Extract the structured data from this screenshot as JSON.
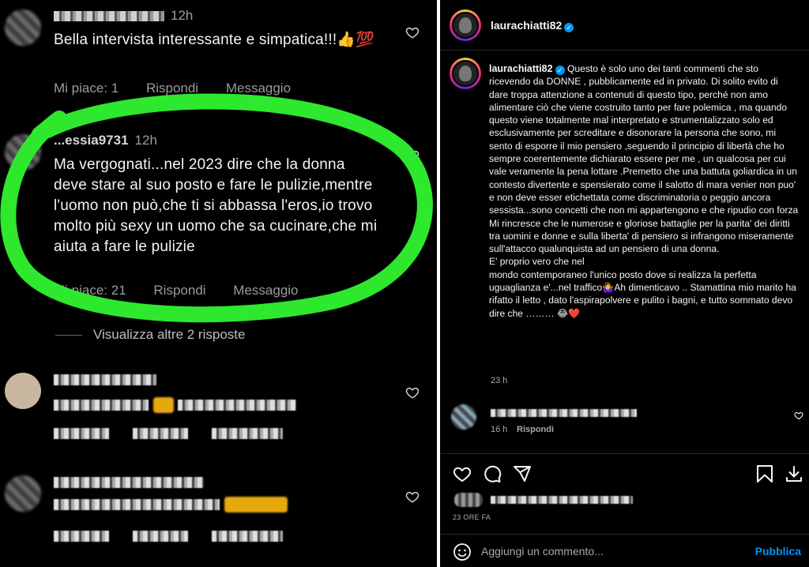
{
  "left_panel": {
    "comments": [
      {
        "time": "12h",
        "text": "Bella intervista interessante e simpatica!!!👍💯",
        "likes": "Mi piace: 1",
        "reply": "Rispondi",
        "message": "Messaggio"
      },
      {
        "username": "...essia9731",
        "time": "12h",
        "text": "Ma vergognati...nel 2023 dire che la donna deve stare al suo posto e fare le pulizie,mentre l'uomo non può,che ti si abbassa l'eros,io trovo molto più sexy un uomo che sa cucinare,che mi aiuta a fare le pulizie",
        "likes": "Mi piace: 21",
        "reply": "Rispondi",
        "message": "Messaggio"
      }
    ],
    "view_more": "Visualizza altre 2 risposte",
    "highlight_color": "#2ee82e"
  },
  "right_panel": {
    "header_username": "laurachiatti82",
    "caption_username": "laurachiatti82",
    "caption_paragraphs": [
      "Questo è solo uno dei tanti commenti che sto ricevendo da DONNE , pubblicamente ed in privato. Di solito evito di dare troppa attenzione a contenuti di questo tipo, perché non amo alimentare ciò che viene costruito tanto per fare polemica , ma quando questo viene totalmente mal interpretato e strumentalizzato solo ed esclusivamente per screditare e disonorare la persona che sono, mi sento di esporre il mio pensiero ,seguendo il principio di libertà che ho sempre coerentemente dichiarato essere per me , un qualcosa per cui vale veramente la pena lottare .Premetto che una battuta goliardica in un contesto divertente e spensierato come il salotto di mara venier non puo' e non deve esser etichettata come discriminatoria o peggio ancora sessista...sono concetti che non mi appartengono e che ripudio con forza",
      "Mi rincresce che le numerose e gloriose battaglie per la parita' dei diritti tra uomini e donne e sulla liberta' di pensiero si infrangono miseramente sull'attacco qualunquista ad un pensiero di una donna.",
      "E' proprio vero che nel",
      "mondo contemporaneo l'unico posto dove si realizza la perfetta uguaglianza e'...nel traffico🤷‍♀️Ah dimenticavo .. Stamattina mio marito ha rifatto il letto , dato l'aspirapolvere e pulito i bagni, e tutto sommato devo dire che ……… 😂❤️"
    ],
    "caption_time": "23 h",
    "reply_time": "16 h",
    "reply_action": "Rispondi",
    "likes_time": "23 ORE FA",
    "add_comment_placeholder": "Aggiungi un commento...",
    "publish_label": "Pubblica",
    "accent": "#0095f6"
  }
}
